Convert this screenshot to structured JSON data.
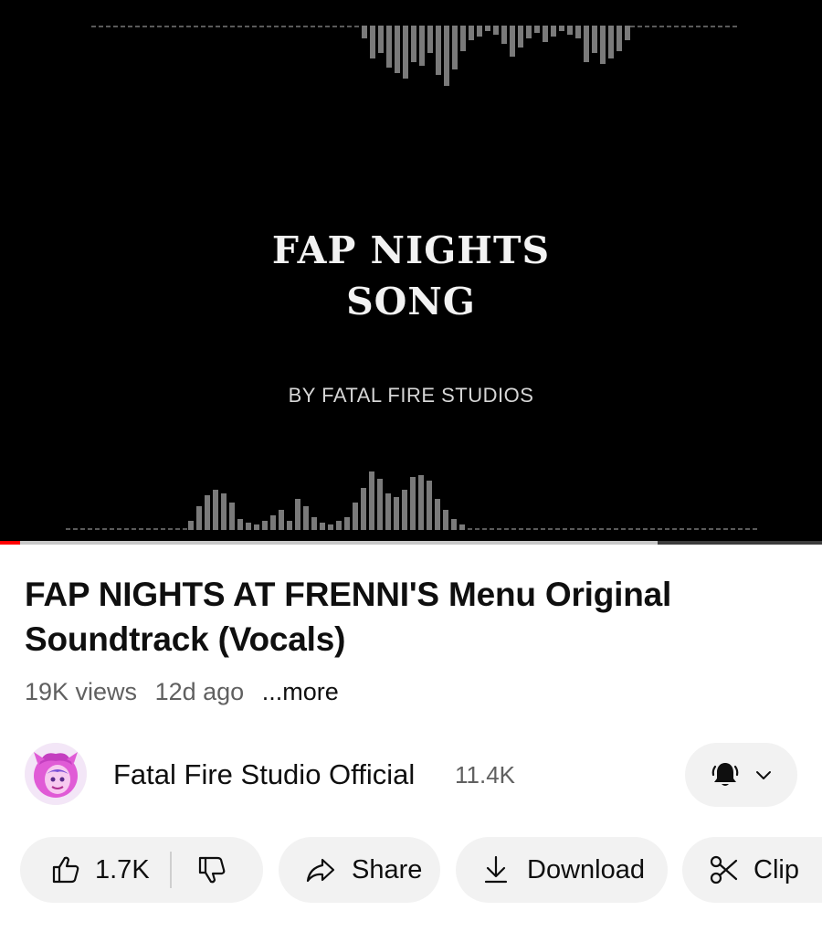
{
  "player": {
    "title_line1": "FAP NIGHTS",
    "title_line2": "SONG",
    "subtitle": "BY FATAL FIRE STUDIOS",
    "progress_played_fraction": 0.024,
    "progress_buffered_fraction": 0.8
  },
  "video": {
    "title": "FAP NIGHTS AT FRENNI'S Menu Original Soundtrack (Vocals)",
    "views": "19K views",
    "age": "12d ago",
    "more_label": "...more"
  },
  "channel": {
    "name": "Fatal Fire Studio Official",
    "subscribers": "11.4K",
    "notification_icon": "bell-filled-icon",
    "dropdown_icon": "chevron-down-icon"
  },
  "actions": {
    "likes": "1.7K",
    "share_label": "Share",
    "download_label": "Download",
    "clip_label": "Clip"
  },
  "colors": {
    "progress_red": "#ff0000",
    "pill_bg": "#f2f2f2",
    "avatar_pink": "#e05bd6",
    "avatar_purple": "#7a4fd6"
  }
}
